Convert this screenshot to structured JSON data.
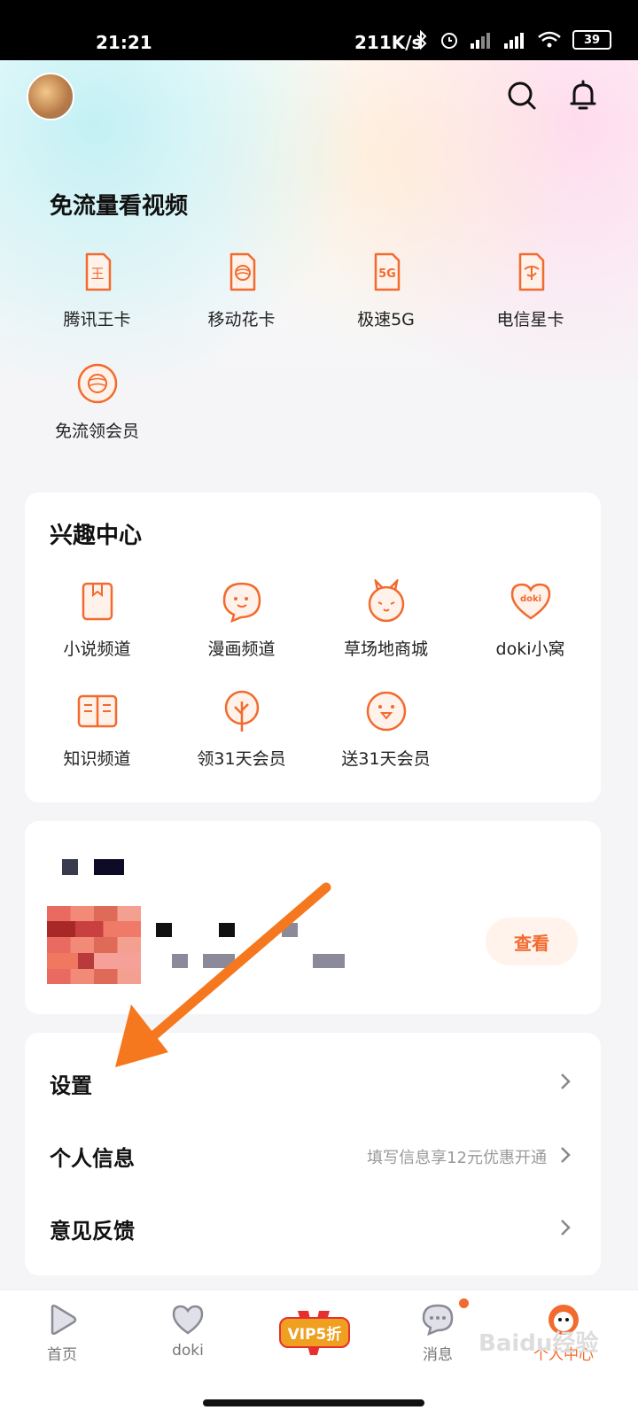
{
  "status_bar": {
    "time": "21:21",
    "network_speed": "211K/s",
    "battery": "39"
  },
  "header": {
    "avatar_icon": "avatar-icon",
    "search_icon": "search-icon",
    "bell_icon": "bell-icon"
  },
  "free_data": {
    "title": "免流量看视频",
    "items": [
      {
        "label": "腾讯王卡",
        "icon": "sim-wang-icon"
      },
      {
        "label": "移动花卡",
        "icon": "sim-mobile-icon"
      },
      {
        "label": "极速5G",
        "icon": "sim-5g-icon"
      },
      {
        "label": "电信星卡",
        "icon": "sim-telecom-icon"
      },
      {
        "label": "免流领会员",
        "icon": "mobile-logo-icon"
      }
    ]
  },
  "interest": {
    "title": "兴趣中心",
    "items": [
      {
        "label": "小说频道",
        "icon": "book-icon"
      },
      {
        "label": "漫画频道",
        "icon": "comic-bubble-icon"
      },
      {
        "label": "草场地商城",
        "icon": "rabbit-icon"
      },
      {
        "label": "doki小窝",
        "icon": "doki-heart-icon"
      },
      {
        "label": "知识频道",
        "icon": "open-book-icon"
      },
      {
        "label": "领31天会员",
        "icon": "tree-icon"
      },
      {
        "label": "送31天会员",
        "icon": "penguin-icon"
      }
    ]
  },
  "promo": {
    "view_label": "查看"
  },
  "settings": {
    "rows": [
      {
        "label": "设置",
        "hint": ""
      },
      {
        "label": "个人信息",
        "hint": "填写信息享12元优惠开通"
      },
      {
        "label": "意见反馈",
        "hint": ""
      }
    ]
  },
  "tabbar": {
    "tabs": [
      {
        "label": "首页"
      },
      {
        "label": "doki"
      },
      {
        "label": "VIP5折"
      },
      {
        "label": "消息"
      },
      {
        "label": "个人中心"
      }
    ]
  },
  "watermark": "Baidu经验",
  "colors": {
    "accent": "#f26a2e",
    "arrow": "#f5781f"
  }
}
